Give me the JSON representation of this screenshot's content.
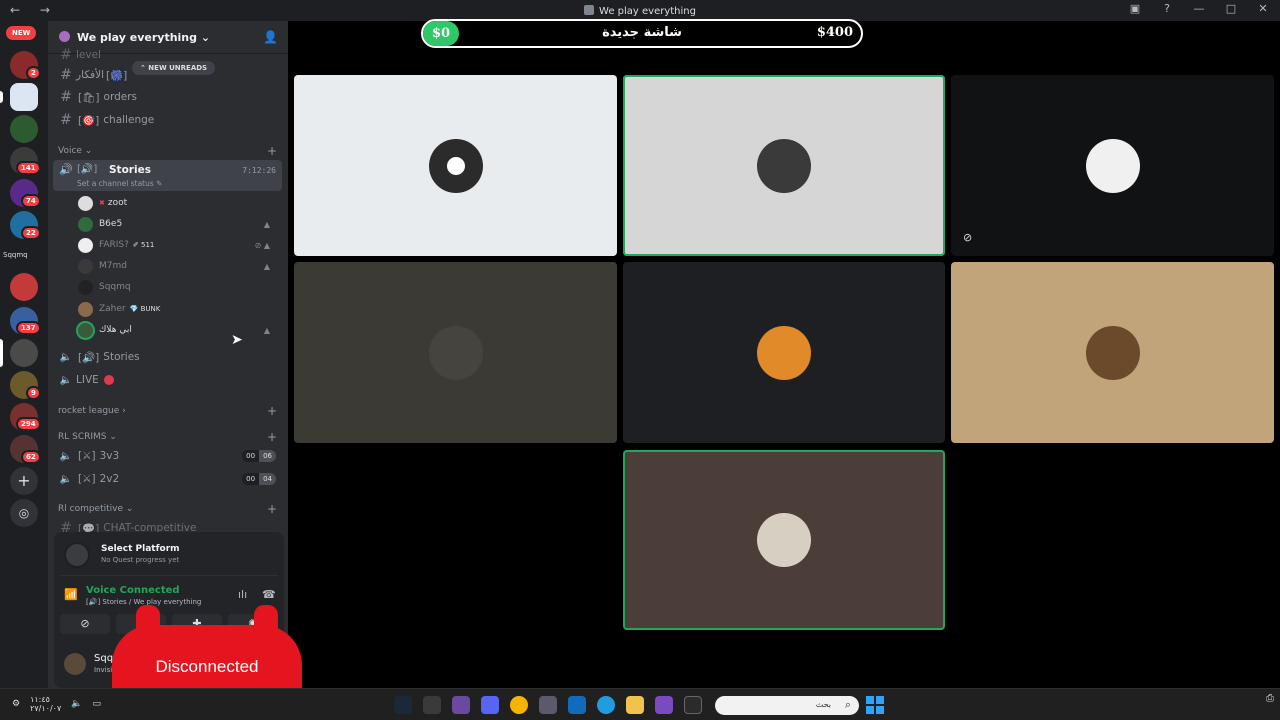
{
  "window": {
    "title": "We play everything",
    "nav": "← →"
  },
  "servers": {
    "new_badge": "NEW",
    "label_sqqmq": "Sqqmq",
    "badges": [
      "2",
      "141",
      "74",
      "22",
      "137",
      "9",
      "294",
      "62"
    ]
  },
  "sidebar": {
    "server_name": "We play everything",
    "new_unreads": "⌃ NEW UNREADS",
    "channels_top": [
      {
        "name": "level"
      },
      {
        "name": "الأفكار"
      },
      {
        "name": "orders"
      },
      {
        "name": "challenge"
      }
    ],
    "voice_category": "Voice ⌄",
    "active_voice": {
      "name": "Stories",
      "status": "Set a channel status ✎",
      "time": "7:12:26"
    },
    "members": [
      {
        "name": "zoot",
        "tag": ""
      },
      {
        "name": "B6e5",
        "tag": ""
      },
      {
        "name": "FARIS?",
        "tag": "511"
      },
      {
        "name": "M7md",
        "tag": ""
      },
      {
        "name": "Sqqmq",
        "tag": ""
      },
      {
        "name": "Zaher",
        "tag": "BUNK"
      },
      {
        "name": "ابي هلاك",
        "tag": ""
      }
    ],
    "voice_channels": [
      {
        "name": "Stories"
      },
      {
        "name": "LIVE"
      }
    ],
    "cat_rocket": "rocket league ›",
    "cat_rl_scrims": "RL SCRIMS ⌄",
    "scrims": [
      {
        "name": "3v3",
        "a": "00",
        "b": "06"
      },
      {
        "name": "2v2",
        "a": "00",
        "b": "04"
      }
    ],
    "cat_rl_comp": "Rl competitive ⌄",
    "chat_comp": "CHAT-competitive"
  },
  "panel": {
    "quest_title": "Select Platform",
    "quest_sub": "No Quest progress yet",
    "voice_title": "Voice Connected",
    "voice_sub": "[🔊] Stories / We play everything",
    "user_name": "Sqqmq",
    "user_status": "Invisible"
  },
  "overlay": {
    "disconnected": "Disconnected"
  },
  "stage": {
    "bar_left": "$0",
    "bar_mid": "شاشة جديدة",
    "bar_right": "$400"
  },
  "taskbar": {
    "time": "١١:٤٥",
    "date": "٢٧/١٠/٠٧",
    "search_placeholder": "بحث"
  },
  "colors": {
    "accent_green": "#23a55a",
    "mention_red": "#f23f43",
    "blurple": "#5865f2"
  }
}
